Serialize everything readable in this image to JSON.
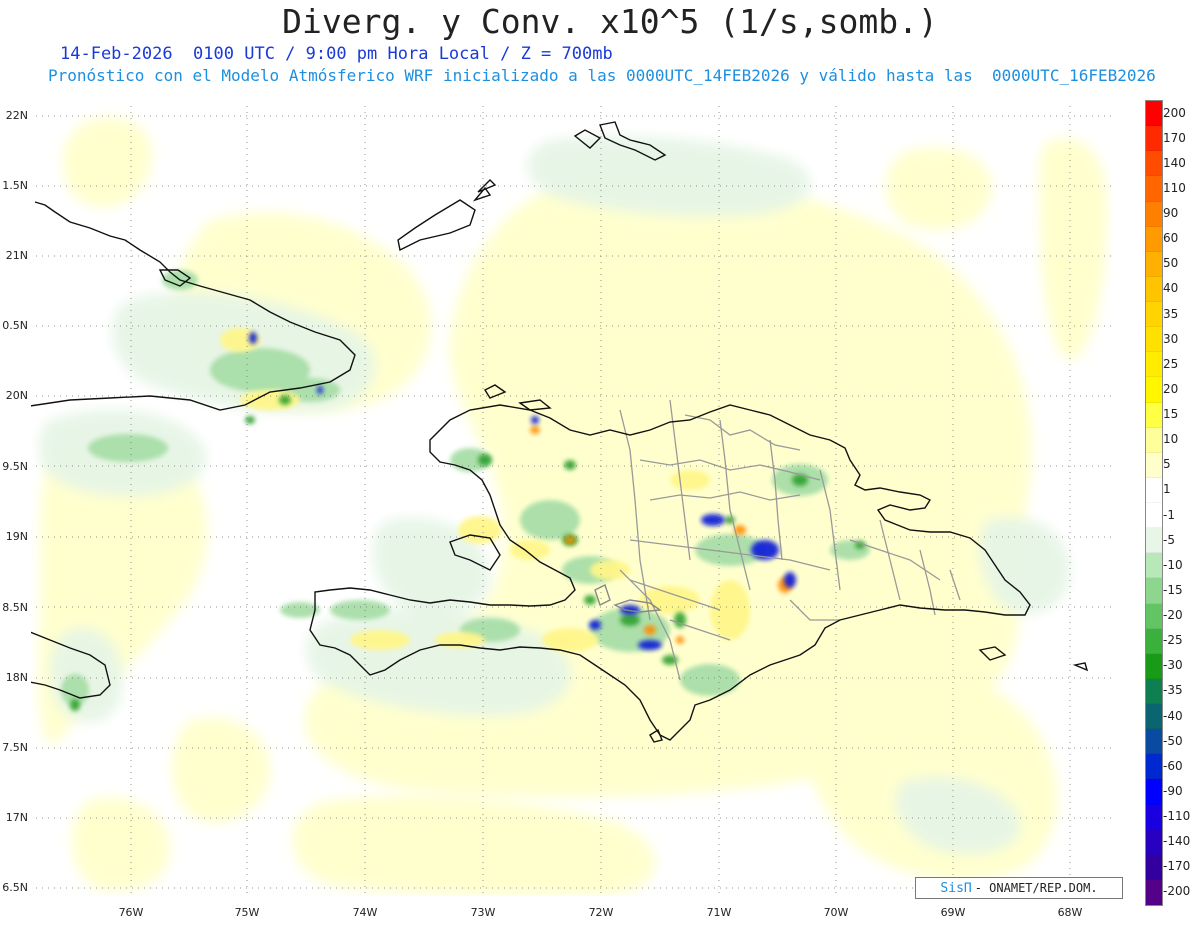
{
  "title": "Diverg. y Conv. x10^5 (1/s,somb.)",
  "subtitle_line1": "14-Feb-2026  0100 UTC / 9:00 pm Hora Local / Z = 700mb",
  "subtitle_line2": "Pronóstico con el Modelo Atmósferico WRF inicializado a las 0000UTC_14FEB2026 y válido hasta las  0000UTC_16FEB2026",
  "lat_labels": [
    "22N",
    "1.5N",
    "21N",
    "0.5N",
    "20N",
    "9.5N",
    "19N",
    "8.5N",
    "18N",
    "7.5N",
    "17N",
    "6.5N"
  ],
  "lon_labels": [
    "76W",
    "75W",
    "74W",
    "73W",
    "72W",
    "71W",
    "70W",
    "69W",
    "68W"
  ],
  "colorbar": {
    "labels": [
      "200",
      "170",
      "140",
      "110",
      "90",
      "60",
      "50",
      "40",
      "35",
      "30",
      "25",
      "20",
      "15",
      "10",
      "5",
      "1",
      "-1",
      "-5",
      "-10",
      "-15",
      "-20",
      "-25",
      "-30",
      "-35",
      "-40",
      "-50",
      "-60",
      "-90",
      "-110",
      "-140",
      "-170",
      "-200"
    ],
    "colors": [
      "#ff0000",
      "#ff2a00",
      "#ff4c00",
      "#ff6600",
      "#ff8000",
      "#ff9a00",
      "#ffb000",
      "#ffc400",
      "#ffd400",
      "#ffe000",
      "#ffec00",
      "#fff600",
      "#ffff44",
      "#ffff99",
      "#ffffcc",
      "#ffffff",
      "#ffffff",
      "#e8f6e8",
      "#b8e8b8",
      "#8ed68e",
      "#62c462",
      "#3cb03c",
      "#189c18",
      "#0d7f50",
      "#0a6570",
      "#0a4aa0",
      "#0028d0",
      "#0000ff",
      "#1a00e0",
      "#2800c0",
      "#3300a0",
      "#550088"
    ]
  },
  "colors": {
    "coast": "#111111",
    "borders": "#999999",
    "grid": "#666666",
    "yellow_light": "#ffffcc",
    "yellow_mid": "#fff68a",
    "green_light": "#e6f5e6",
    "green_mid": "#a8dea8",
    "green_dark": "#2ea02e",
    "orange": "#ff8c00",
    "blue": "#0a1ad8"
  },
  "credit": {
    "brand": "SisΠ",
    "org": "- ONAMET/REP.DOM."
  }
}
